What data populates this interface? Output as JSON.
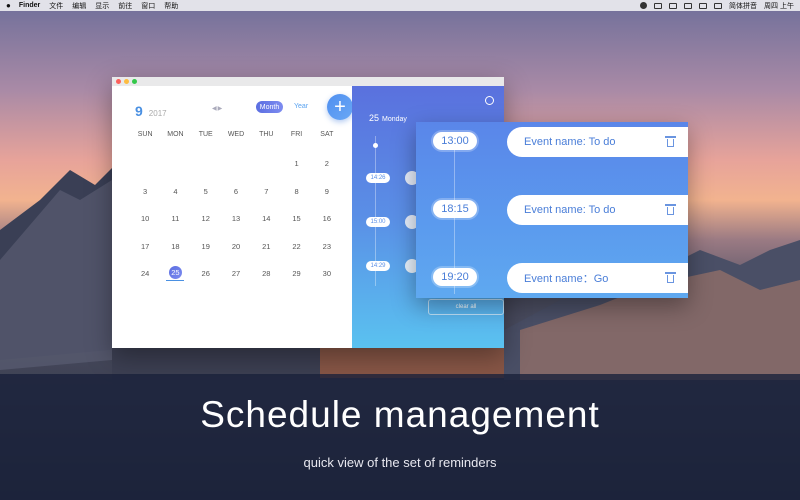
{
  "menubar": {
    "app_name": "Finder",
    "items": [
      "文件",
      "编辑",
      "显示",
      "前往",
      "窗口",
      "帮助"
    ],
    "input_method": "简体拼音",
    "clock": "周四 上午"
  },
  "calendar": {
    "month": "9",
    "year": "2017",
    "tab_month": "Month",
    "tab_year": "Year",
    "add_label": "+",
    "weekdays": [
      "SUN",
      "MON",
      "TUE",
      "WED",
      "THU",
      "FRI",
      "SAT"
    ],
    "days": [
      "",
      "",
      "",
      "",
      "",
      "1",
      "2",
      "3",
      "4",
      "5",
      "6",
      "7",
      "8",
      "9",
      "10",
      "11",
      "12",
      "13",
      "14",
      "15",
      "16",
      "17",
      "18",
      "19",
      "20",
      "21",
      "22",
      "23",
      "24",
      "25",
      "26",
      "27",
      "28",
      "29",
      "30"
    ],
    "selected_day": "25"
  },
  "side": {
    "date_day": "25",
    "date_weekday": "Monday",
    "times": [
      "14:26",
      "15:00",
      "14:29"
    ],
    "clear_all": "clear all"
  },
  "events": [
    {
      "time": "13:00",
      "name": "Event name: To do"
    },
    {
      "time": "18:15",
      "name": "Event name: To do"
    },
    {
      "time": "19:20",
      "name": "Event name：Go"
    }
  ],
  "banner": {
    "headline": "Schedule management",
    "subline": "quick view of the set of reminders"
  },
  "colors": {
    "accent": "#4a90e2",
    "gradient_start": "#5a71de",
    "gradient_end": "#5ac2f0"
  }
}
